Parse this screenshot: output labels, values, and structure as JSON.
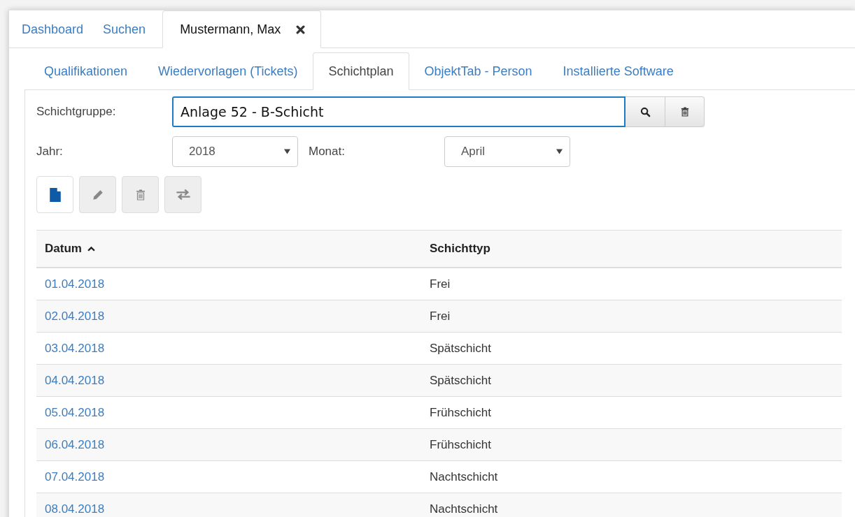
{
  "main_tabs": [
    {
      "label": "Dashboard",
      "selected": false,
      "closable": false
    },
    {
      "label": "Suchen",
      "selected": false,
      "closable": false
    },
    {
      "label": "Mustermann, Max",
      "selected": true,
      "closable": true
    }
  ],
  "sub_tabs": [
    {
      "label": "Qualifikationen",
      "selected": false
    },
    {
      "label": "Wiedervorlagen (Tickets)",
      "selected": false
    },
    {
      "label": "Schichtplan",
      "selected": true
    },
    {
      "label": "ObjektTab - Person",
      "selected": false
    },
    {
      "label": "Installierte Software",
      "selected": false
    }
  ],
  "schichtgruppe": {
    "label": "Schichtgruppe:",
    "value": "Anlage 52 - B-Schicht"
  },
  "jahr": {
    "label": "Jahr:",
    "value": "2018"
  },
  "monat": {
    "label": "Monat:",
    "value": "April"
  },
  "toolbar": [
    {
      "kind": "new",
      "disabled": false
    },
    {
      "kind": "edit",
      "disabled": true
    },
    {
      "kind": "delete",
      "disabled": true
    },
    {
      "kind": "swap",
      "disabled": true
    }
  ],
  "table": {
    "columns": [
      {
        "label": "Datum",
        "sorted": true
      },
      {
        "label": "Schichttyp",
        "sorted": false
      }
    ],
    "rows": [
      {
        "datum": "01.04.2018",
        "schichttyp": "Frei"
      },
      {
        "datum": "02.04.2018",
        "schichttyp": "Frei"
      },
      {
        "datum": "03.04.2018",
        "schichttyp": "Spätschicht"
      },
      {
        "datum": "04.04.2018",
        "schichttyp": "Spätschicht"
      },
      {
        "datum": "05.04.2018",
        "schichttyp": "Frühschicht"
      },
      {
        "datum": "06.04.2018",
        "schichttyp": "Frühschicht"
      },
      {
        "datum": "07.04.2018",
        "schichttyp": "Nachtschicht"
      },
      {
        "datum": "08.04.2018",
        "schichttyp": "Nachtschicht"
      }
    ]
  }
}
